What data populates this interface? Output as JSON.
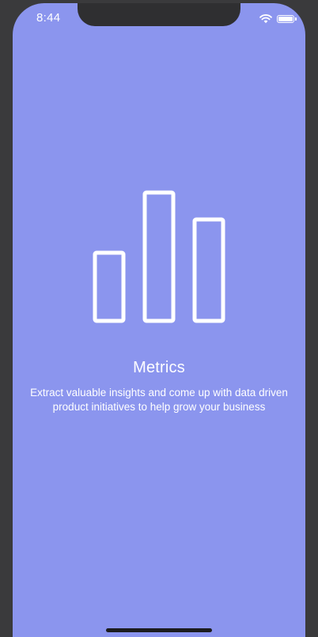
{
  "status_bar": {
    "time": "8:44",
    "wifi_icon": "wifi-icon",
    "battery_icon": "battery-icon"
  },
  "onboarding": {
    "icon": "bar-chart-icon",
    "title": "Metrics",
    "description_line1": "Extract valuable insights and come up with data driven",
    "description_line2": "product initiatives to help grow your business"
  },
  "colors": {
    "background": "#8b95ee",
    "foreground": "#ffffff",
    "device_frame": "#3a3a3c"
  }
}
